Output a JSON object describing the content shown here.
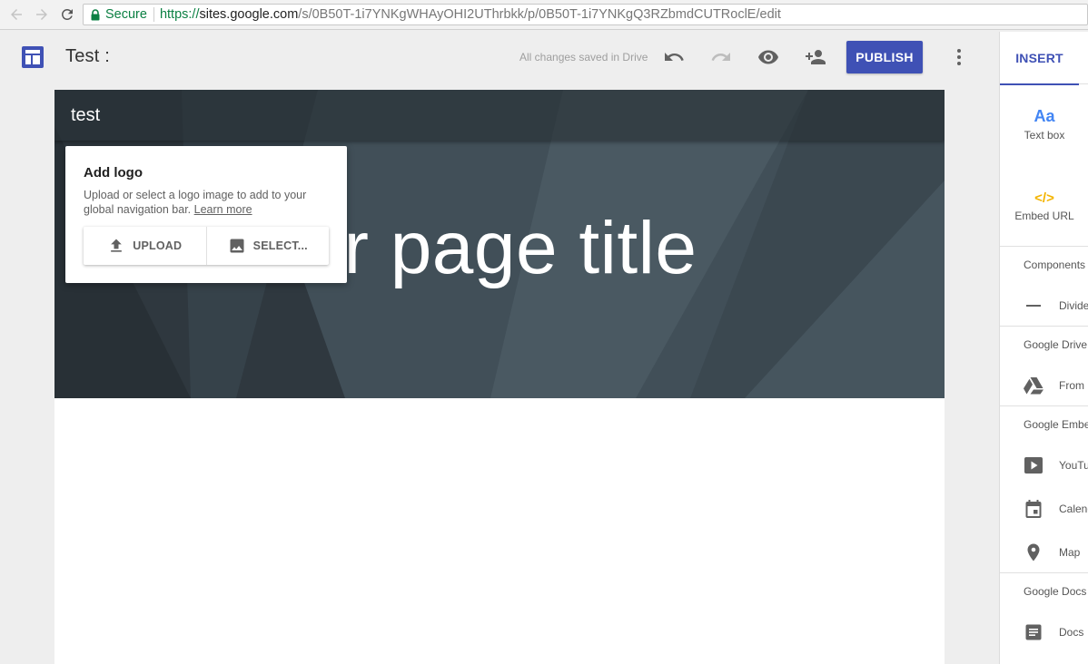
{
  "browser": {
    "secure_label": "Secure",
    "url_scheme": "https://",
    "url_host": "sites.google.com",
    "url_path": "/s/0B50T-1i7YNKgWHAyOHI2UThrbkk/p/0B50T-1i7YNKgQ3RZbmdCUTRoclE/edit"
  },
  "header": {
    "site_title": "Test :",
    "save_status": "All changes saved in Drive",
    "publish_label": "PUBLISH"
  },
  "hero": {
    "nav_title": "test",
    "page_title": "ur page title"
  },
  "logo_popup": {
    "title": "Add logo",
    "description": "Upload or select a logo image to add to your global navigation bar.",
    "link": "Learn more",
    "upload_label": "UPLOAD",
    "select_label": "SELECT..."
  },
  "insert_panel": {
    "tab": "INSERT",
    "text_box_glyph": "Aa",
    "text_box": "Text box",
    "embed_glyph": "</>",
    "embed_url": "Embed URL",
    "components_head": "Components",
    "divider": "Divide",
    "drive_head": "Google Drive",
    "from_drive": "From I",
    "embed_head": "Google Embe",
    "youtube": "YouTu",
    "calendar": "Calend",
    "map": "Map",
    "docs_head": "Google Docs",
    "docs": "Docs"
  },
  "colors": {
    "accent": "#3f51b5",
    "secure_green": "#0b8043",
    "hero_bg": "#414f58",
    "text_box_blue": "#4285f4",
    "embed_yellow": "#f4b400"
  }
}
